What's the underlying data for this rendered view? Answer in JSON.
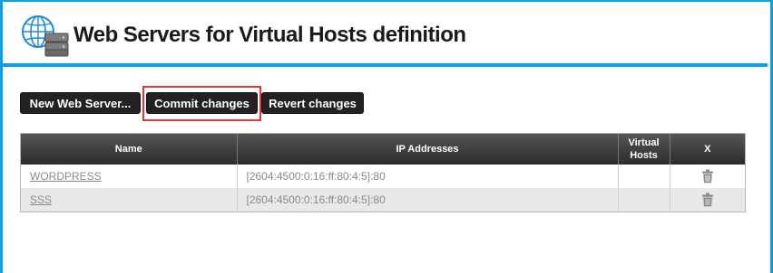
{
  "header": {
    "title": "Web Servers for Virtual Hosts definition",
    "logo_icon": "web-server-globe-icon"
  },
  "toolbar": {
    "new_label": "New Web Server...",
    "commit_label": "Commit changes",
    "revert_label": "Revert changes"
  },
  "table": {
    "columns": [
      "Name",
      "IP Addresses",
      "Virtual\nHosts",
      "X"
    ],
    "column_virtual_line1": "Virtual",
    "column_virtual_line2": "Hosts",
    "rows": [
      {
        "name": "WORDPRESS",
        "ip": "[2604:4500:0:16:ff:80:4:5]:80",
        "virtual_hosts": "",
        "delete_icon": "trash-icon"
      },
      {
        "name": "SSS",
        "ip": "[2604:4500:0:16:ff:80:4:5]:80",
        "virtual_hosts": "",
        "delete_icon": "trash-icon"
      }
    ]
  },
  "colors": {
    "accent": "#0aa0e6",
    "highlight": "#e8353b",
    "button_bg": "#222222"
  }
}
